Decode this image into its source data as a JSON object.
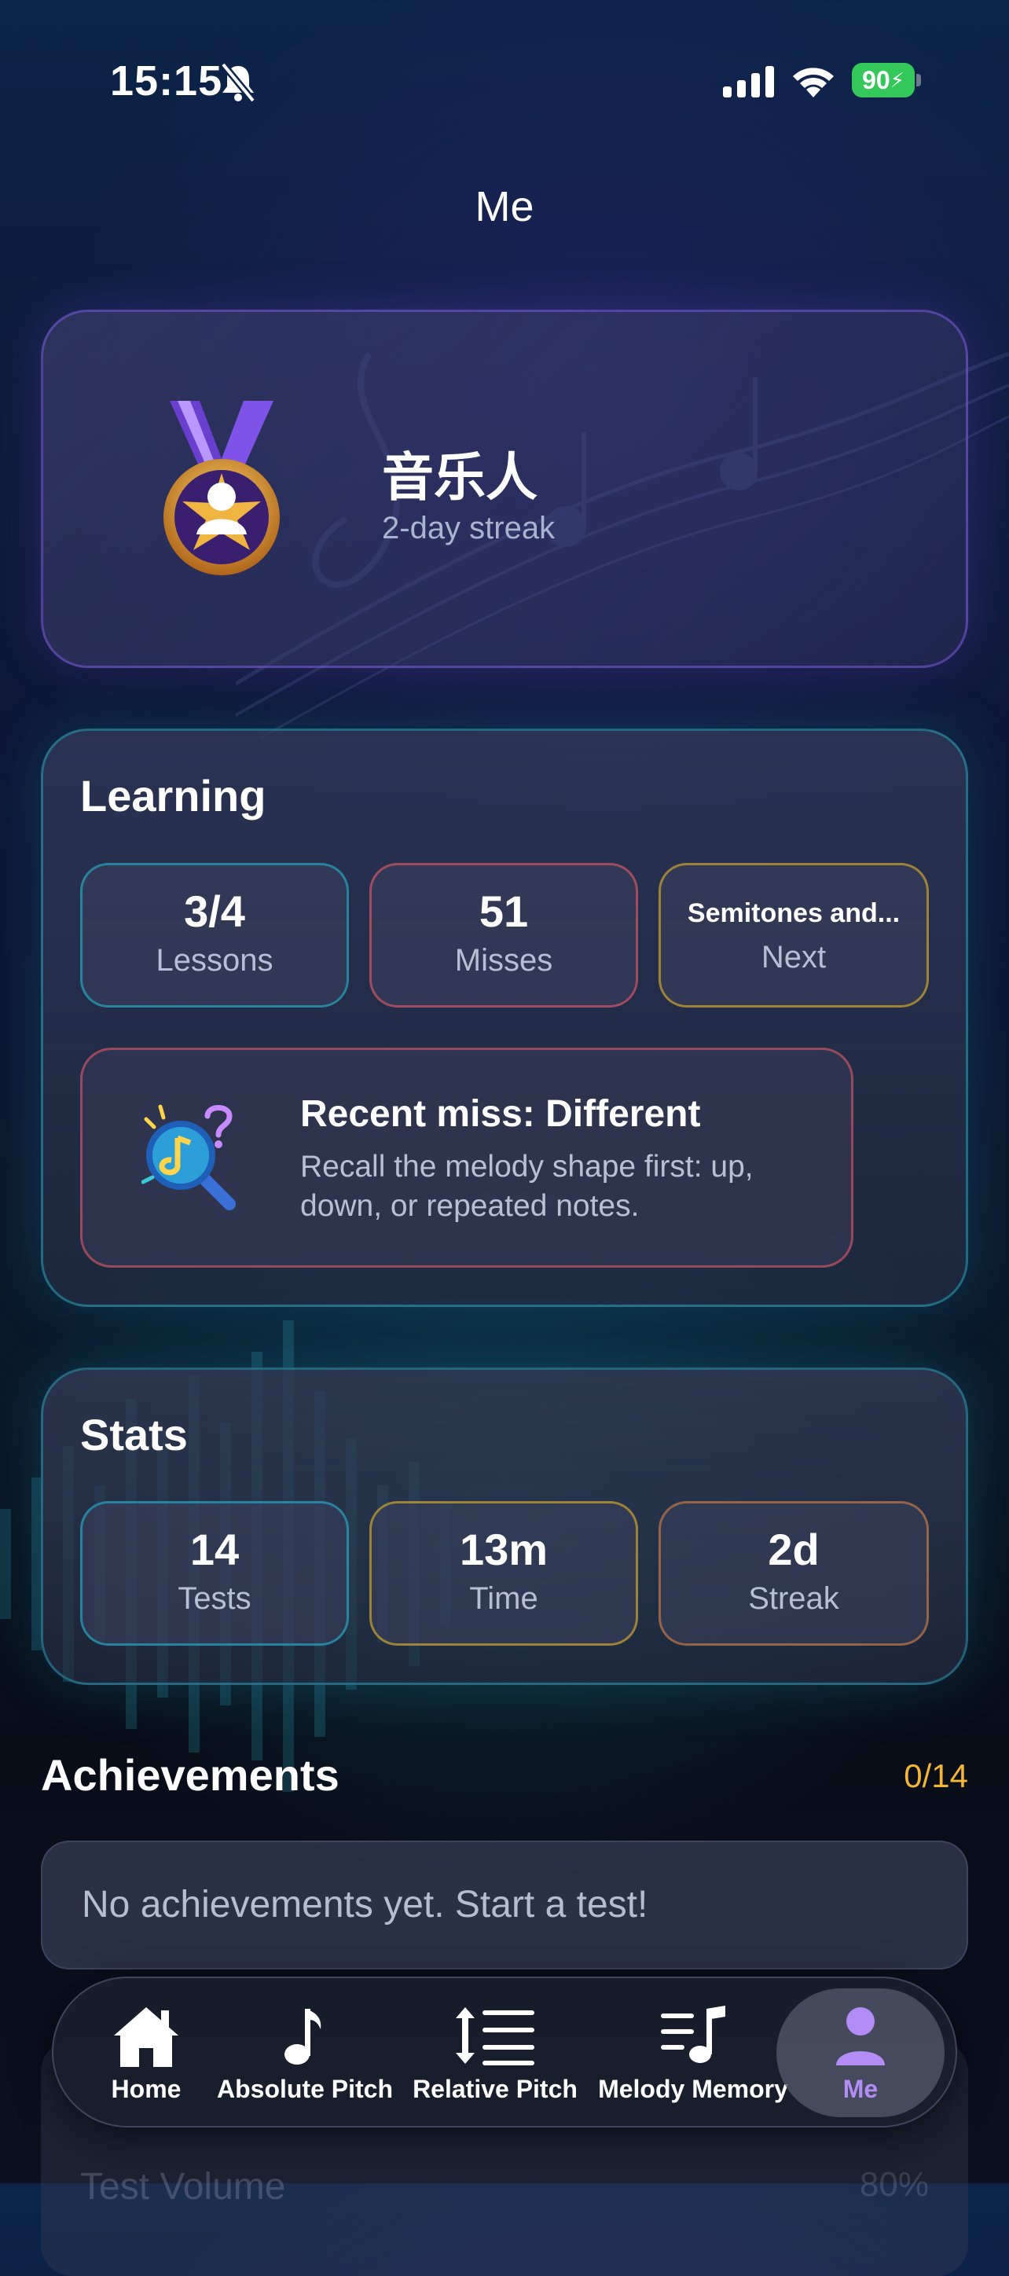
{
  "status_bar": {
    "time": "15:15",
    "battery": "90"
  },
  "header": {
    "title": "Me"
  },
  "profile": {
    "name": "音乐人",
    "subtitle": "2-day streak"
  },
  "learning": {
    "title": "Learning",
    "tiles": [
      {
        "value": "3/4",
        "label": "Lessons"
      },
      {
        "value": "51",
        "label": "Misses"
      },
      {
        "value": "Semitones and...",
        "label": "Next"
      }
    ],
    "recent_miss": {
      "title": "Recent miss: Different",
      "body": "Recall the melody shape first: up, down, or repeated notes."
    }
  },
  "stats": {
    "title": "Stats",
    "tiles": [
      {
        "value": "14",
        "label": "Tests"
      },
      {
        "value": "13m",
        "label": "Time"
      },
      {
        "value": "2d",
        "label": "Streak"
      }
    ]
  },
  "achievements": {
    "title": "Achievements",
    "count": "0/14",
    "empty_text": "No achievements yet. Start a test!"
  },
  "settings_peek": {
    "label": "Test Volume",
    "value": "80%"
  },
  "tabbar": {
    "items": [
      {
        "label": "Home",
        "icon": "house-icon"
      },
      {
        "label": "Absolute Pitch",
        "icon": "music-note-icon"
      },
      {
        "label": "Relative Pitch",
        "icon": "interval-list-icon"
      },
      {
        "label": "Melody Memory",
        "icon": "melody-list-icon"
      },
      {
        "label": "Me",
        "icon": "person-icon",
        "active": true
      }
    ]
  },
  "colors": {
    "accent": "#b38cf5",
    "gold": "#f2b535",
    "teal": "#2896af",
    "battery": "#34c759"
  }
}
